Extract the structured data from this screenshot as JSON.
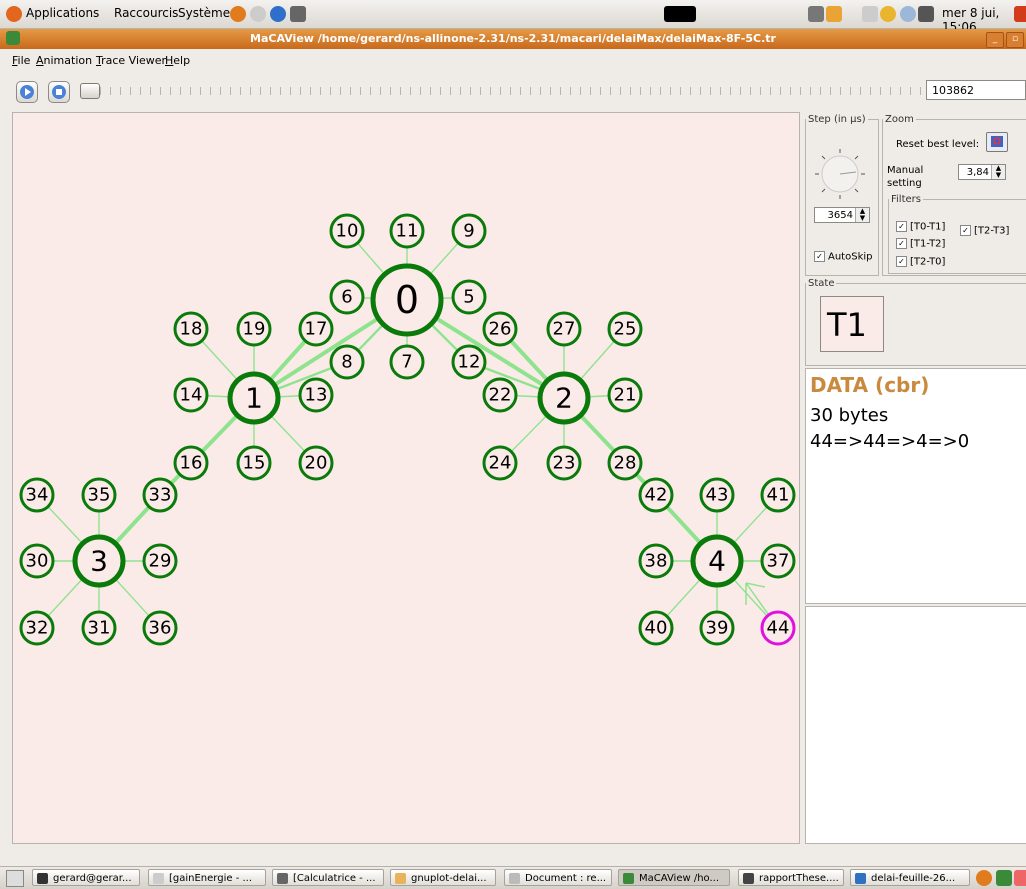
{
  "panel": {
    "menus": [
      "Applications",
      "Raccourcis",
      "Système"
    ],
    "clock": "mer 8 jui, 15:06"
  },
  "window": {
    "title": "MaCAView /home/gerard/ns-allinone-2.31/ns-2.31/macari/delaiMax/delaiMax-8F-5C.tr"
  },
  "menubar": [
    "File",
    "Animation",
    "Trace Viewer",
    "Help"
  ],
  "playback": {
    "time": "103862"
  },
  "step": {
    "legend": "Step (in µs)",
    "value": "3654",
    "autoskip_label": "AutoSkip",
    "autoskip_checked": true
  },
  "zoom": {
    "legend": "Zoom",
    "reset_label": "Reset best level:",
    "manual_label_1": "Manual",
    "manual_label_2": "setting",
    "value": "3,84"
  },
  "filters": {
    "legend": "Filters",
    "items": [
      {
        "label": "[T0-T1]",
        "checked": true
      },
      {
        "label": "[T1-T2]",
        "checked": true
      },
      {
        "label": "[T2-T0]",
        "checked": true
      },
      {
        "label": "[T2-T3]",
        "checked": true
      }
    ]
  },
  "state": {
    "legend": "State",
    "value": "T1"
  },
  "packet": {
    "title": "DATA (cbr)",
    "size": "30 bytes",
    "route": "44=>44=>4=>0"
  },
  "colors": {
    "node_stroke": "#0a7a0a",
    "link": "#8fe38f",
    "highlight": "#e011e0",
    "canvas": "#fbebe8"
  },
  "network": {
    "coordinators": [
      "0",
      "1",
      "2",
      "3",
      "4"
    ],
    "nodes": [
      "5",
      "6",
      "7",
      "8",
      "9",
      "10",
      "11",
      "12",
      "13",
      "14",
      "15",
      "16",
      "17",
      "18",
      "19",
      "20",
      "21",
      "22",
      "23",
      "24",
      "25",
      "26",
      "27",
      "28",
      "29",
      "30",
      "31",
      "32",
      "33",
      "34",
      "35",
      "36",
      "37",
      "38",
      "39",
      "40",
      "41",
      "42",
      "43",
      "44"
    ],
    "highlighted_node": "44"
  },
  "taskbar": [
    "gerard@gerar...",
    "[gainEnergie - ...",
    "[Calculatrice - ...",
    "gnuplot-delai...",
    "Document : re...",
    "MaCAView /ho...",
    "rapportThese....",
    "delai-feuille-26..."
  ]
}
